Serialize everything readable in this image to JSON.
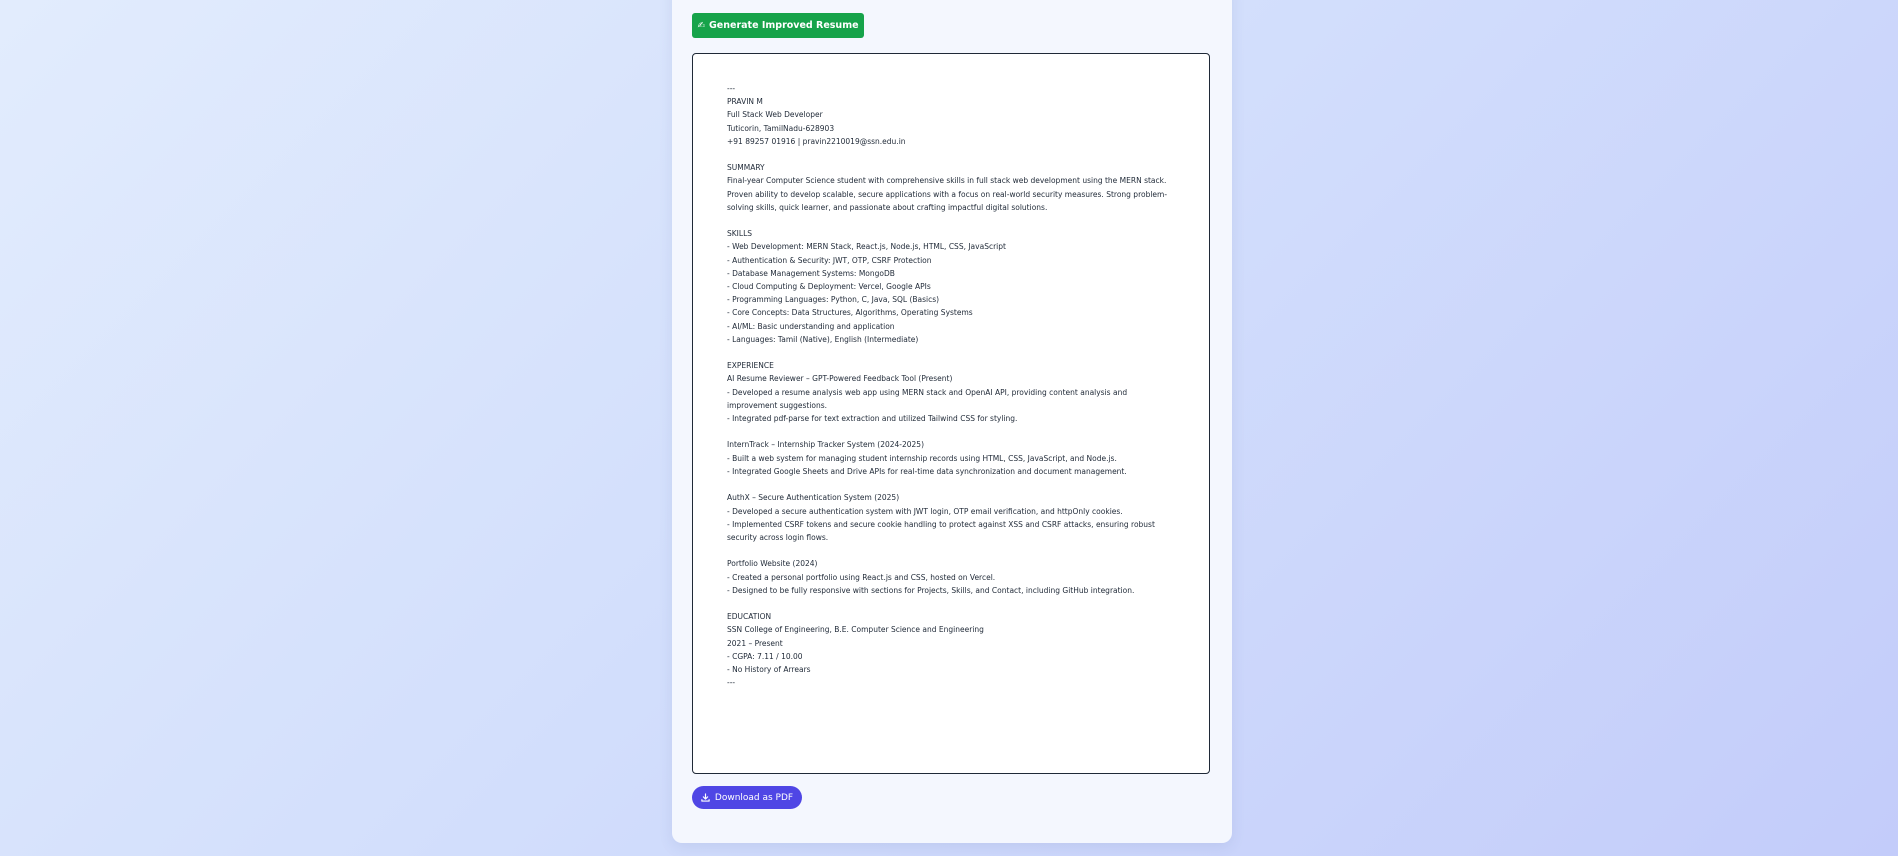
{
  "actions": {
    "generate_label": "Generate Improved Resume",
    "generate_icon": "writing-hand-icon",
    "download_label": "Download as PDF",
    "download_icon": "download-icon"
  },
  "colors": {
    "generate_button": "#16a34a",
    "download_button": "#4f46e5",
    "editor_border": "#1f2937"
  },
  "resume": {
    "text": "---\nPRAVIN M\nFull Stack Web Developer\nTuticorin, TamilNadu-628903\n+91 89257 01916 | pravin2210019@ssn.edu.in\n\nSUMMARY\nFinal-year Computer Science student with comprehensive skills in full stack web development using the MERN stack. Proven ability to develop scalable, secure applications with a focus on real-world security measures. Strong problem-solving skills, quick learner, and passionate about crafting impactful digital solutions.\n\nSKILLS\n- Web Development: MERN Stack, React.js, Node.js, HTML, CSS, JavaScript\n- Authentication & Security: JWT, OTP, CSRF Protection\n- Database Management Systems: MongoDB\n- Cloud Computing & Deployment: Vercel, Google APIs\n- Programming Languages: Python, C, Java, SQL (Basics)\n- Core Concepts: Data Structures, Algorithms, Operating Systems\n- AI/ML: Basic understanding and application\n- Languages: Tamil (Native), English (Intermediate)\n\nEXPERIENCE\nAI Resume Reviewer – GPT-Powered Feedback Tool (Present)\n- Developed a resume analysis web app using MERN stack and OpenAI API, providing content analysis and improvement suggestions.\n- Integrated pdf-parse for text extraction and utilized Tailwind CSS for styling.\n\nInternTrack – Internship Tracker System (2024-2025)\n- Built a web system for managing student internship records using HTML, CSS, JavaScript, and Node.js.\n- Integrated Google Sheets and Drive APIs for real-time data synchronization and document management.\n\nAuthX – Secure Authentication System (2025)\n- Developed a secure authentication system with JWT login, OTP email verification, and httpOnly cookies.\n- Implemented CSRF tokens and secure cookie handling to protect against XSS and CSRF attacks, ensuring robust security across login flows.\n\nPortfolio Website (2024)\n- Created a personal portfolio using React.js and CSS, hosted on Vercel.\n- Designed to be fully responsive with sections for Projects, Skills, and Contact, including GitHub integration.\n\nEDUCATION\nSSN College of Engineering, B.E. Computer Science and Engineering\n2021 – Present\n- CGPA: 7.11 / 10.00\n- No History of Arrears\n---"
  }
}
